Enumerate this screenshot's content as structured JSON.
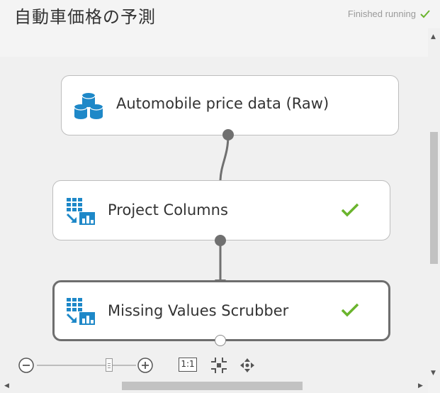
{
  "header": {
    "title": "自動車価格の予測",
    "status_text": "Finished running"
  },
  "modules": [
    {
      "label": "Automobile price data (Raw)",
      "icon": "dataset-icon",
      "status": ""
    },
    {
      "label": "Project Columns",
      "icon": "project-columns-icon",
      "status": "success"
    },
    {
      "label": "Missing Values Scrubber",
      "icon": "project-columns-icon",
      "status": "success"
    }
  ],
  "toolbar": {
    "zoom_actual_label": "1:1",
    "zoom_level": 0.78
  },
  "colors": {
    "check": "#6ab42d",
    "icon_blue": "#1e88c8"
  }
}
